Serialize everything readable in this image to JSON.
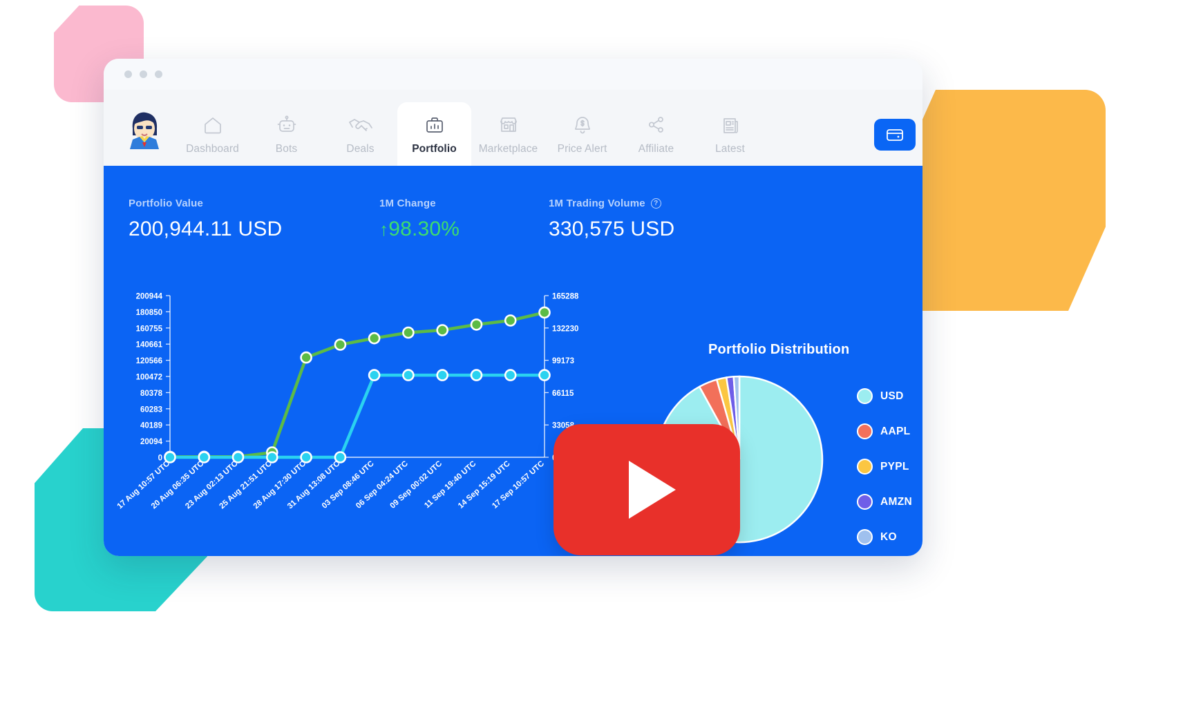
{
  "window": {
    "traffic_lights": [
      "dot-1",
      "dot-2",
      "dot-3"
    ]
  },
  "nav": {
    "avatar_alt": "user-avatar",
    "items": [
      {
        "label": "Dashboard",
        "icon": "home-icon",
        "active": false
      },
      {
        "label": "Bots",
        "icon": "robot-icon",
        "active": false
      },
      {
        "label": "Deals",
        "icon": "handshake-icon",
        "active": false
      },
      {
        "label": "Portfolio",
        "icon": "briefcase-icon",
        "active": true
      },
      {
        "label": "Marketplace",
        "icon": "storefront-icon",
        "active": false
      },
      {
        "label": "Price Alert",
        "icon": "bell-dollar-icon",
        "active": false
      },
      {
        "label": "Affiliate",
        "icon": "share-icon",
        "active": false
      },
      {
        "label": "Latest",
        "icon": "news-icon",
        "active": false
      }
    ],
    "cta_icon": "wallet-icon"
  },
  "stats": [
    {
      "label": "Portfolio Value",
      "value": "200,944.11 USD",
      "accent": false,
      "help": false
    },
    {
      "label": "1M Change",
      "value": "98.30%",
      "arrow": "↑",
      "accent": true,
      "help": false
    },
    {
      "label": "1M Trading Volume",
      "value": "330,575 USD",
      "accent": false,
      "help": true
    }
  ],
  "colors": {
    "page_blue": "#0b64f4",
    "green_line": "#5cbb46",
    "cyan_line": "#2ad2f0",
    "positive": "#3ddc6e",
    "label_blue": "#b9d3fd",
    "play_red": "#e8302a"
  },
  "pie_title": "Portfolio Distribution",
  "legend": [
    {
      "label": "USD",
      "color": "#9cedf0"
    },
    {
      "label": "AAPL",
      "color": "#f2705a"
    },
    {
      "label": "PYPL",
      "color": "#fbc642"
    },
    {
      "label": "AMZN",
      "color": "#6f5ee8"
    },
    {
      "label": "KO",
      "color": "#9fc0ee"
    }
  ],
  "chart_data": {
    "type": "line",
    "title": "",
    "xlabel": "",
    "ylabel": "",
    "grid": false,
    "legend_position": "right",
    "x": [
      "17 Aug 10:57 UTC",
      "20 Aug 06:35 UTC",
      "23 Aug 02:13 UTC",
      "25 Aug 21:51 UTC",
      "28 Aug 17:30 UTC",
      "31 Aug 13:08 UTC",
      "03 Sep 08:46 UTC",
      "06 Sep 04:24 UTC",
      "09 Sep 00:02 UTC",
      "11 Sep 19:40 UTC",
      "14 Sep 15:19 UTC",
      "17 Sep 10:57 UTC"
    ],
    "left_axis": {
      "ticks": [
        200944,
        180850,
        160755,
        140661,
        120566,
        100472,
        80378,
        60283,
        40189,
        20094,
        0
      ],
      "ylim": [
        0,
        200944
      ]
    },
    "right_axis": {
      "ticks": [
        165288,
        132230,
        99173,
        66115,
        33058,
        0
      ],
      "ylim": [
        0,
        165288
      ]
    },
    "series": [
      {
        "name": "Portfolio Value",
        "color": "#5cbb46",
        "axis": "left",
        "values": [
          500,
          600,
          700,
          6000,
          124000,
          140000,
          148000,
          155000,
          158000,
          165000,
          170000,
          180000
        ]
      },
      {
        "name": "Trading Volume",
        "color": "#2ad2f0",
        "axis": "right",
        "values": [
          0,
          0,
          0,
          0,
          0,
          0,
          84000,
          84000,
          84000,
          84000,
          84000,
          84000
        ]
      }
    ]
  },
  "pie_chart": {
    "type": "pie",
    "title": "Portfolio Distribution",
    "slices": [
      {
        "label": "USD",
        "value": 92.0,
        "color": "#9cedf0"
      },
      {
        "label": "AAPL",
        "value": 3.6,
        "color": "#f2705a"
      },
      {
        "label": "PYPL",
        "value": 1.9,
        "color": "#fbc642"
      },
      {
        "label": "AMZN",
        "value": 1.4,
        "color": "#6f5ee8"
      },
      {
        "label": "KO",
        "value": 1.1,
        "color": "#9fc0ee"
      }
    ]
  }
}
